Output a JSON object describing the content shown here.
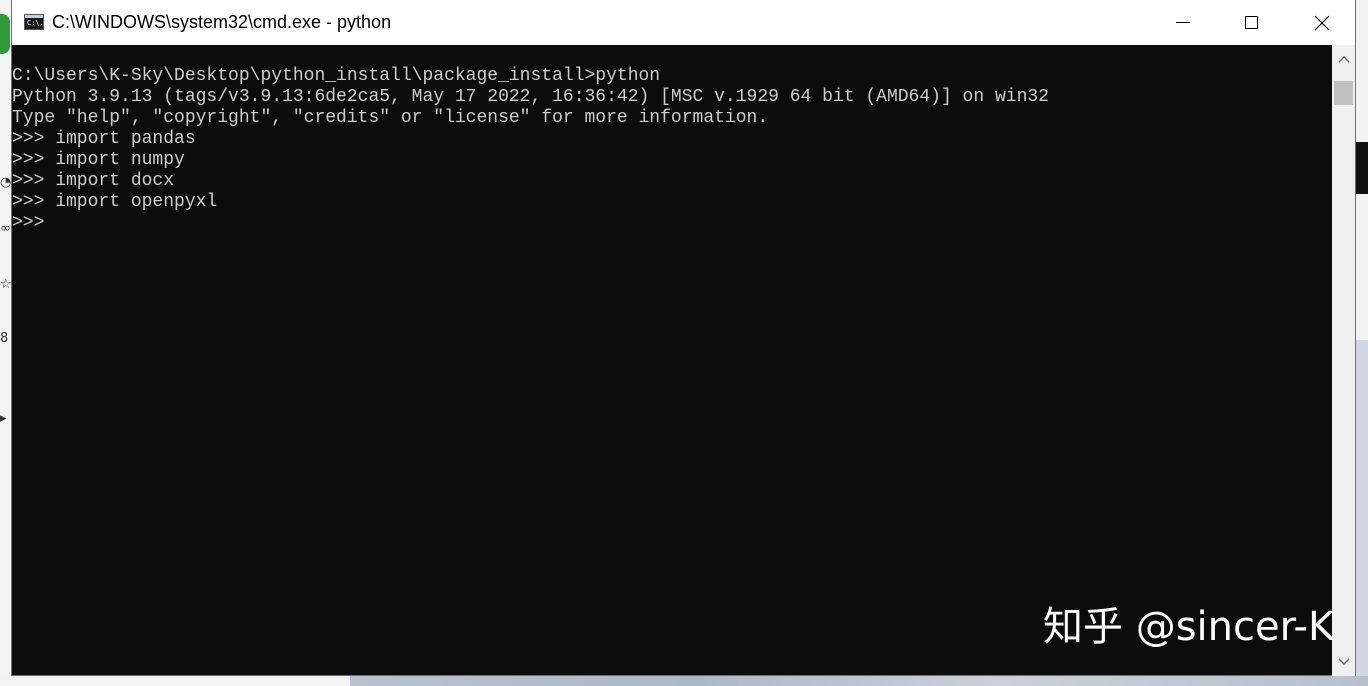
{
  "window": {
    "title": "C:\\WINDOWS\\system32\\cmd.exe - python",
    "icon_label": "C:\\."
  },
  "console": {
    "lines": [
      "C:\\Users\\K-Sky\\Desktop\\python_install\\package_install>python",
      "Python 3.9.13 (tags/v3.9.13:6de2ca5, May 17 2022, 16:36:42) [MSC v.1929 64 bit (AMD64)] on win32",
      "Type \"help\", \"copyright\", \"credits\" or \"license\" for more information.",
      ">>> import pandas",
      ">>> import numpy",
      ">>> import docx",
      ">>> import openpyxl",
      ">>>"
    ]
  },
  "watermark": {
    "text": "知乎 @sincer-K"
  },
  "icons": {
    "app": "cmd-icon",
    "minimize": "minimize-icon",
    "maximize": "maximize-icon",
    "close": "close-icon",
    "scroll_up": "chevron-up-icon",
    "scroll_down": "chevron-down-icon"
  },
  "colors": {
    "console_bg": "#0c0c0c",
    "console_text": "#cccccc",
    "titlebar_bg": "#ffffff"
  }
}
